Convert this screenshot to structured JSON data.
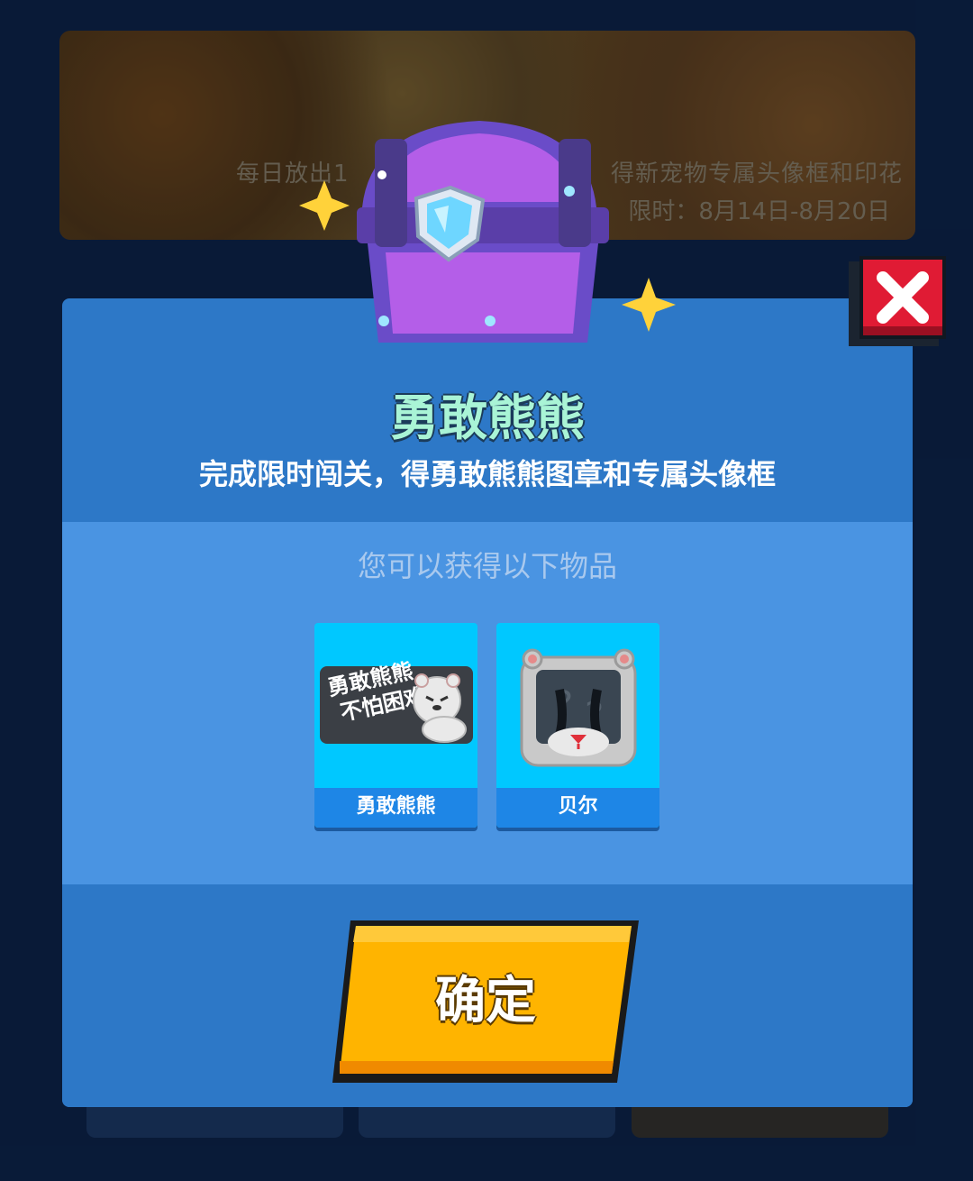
{
  "background": {
    "banner": {
      "line1_left": "每日放出1",
      "line1_right": "得新宠物专属头像框和印花",
      "line2": "限时：8月14日-8月20日"
    }
  },
  "dialog": {
    "title": "勇敢熊熊",
    "subtitle": "完成限时闯关，得勇敢熊熊图章和专属头像框",
    "rewards_label": "您可以获得以下物品",
    "items": [
      {
        "name": "勇敢熊熊",
        "stamp_text_line1": "勇敢熊熊",
        "stamp_text_line2": "不怕困难",
        "icon": "stamp-icon"
      },
      {
        "name": "贝尔",
        "icon": "bear-avatar-frame-icon"
      }
    ],
    "confirm_label": "确定",
    "close_icon": "close-x-icon"
  },
  "colors": {
    "dialog_blue": "#2d78c7",
    "panel_blue": "#4a94e2",
    "item_cyan": "#00c8ff",
    "confirm_yellow": "#ffb400",
    "close_red": "#e01b34",
    "title_mint": "#a9f4d6"
  }
}
